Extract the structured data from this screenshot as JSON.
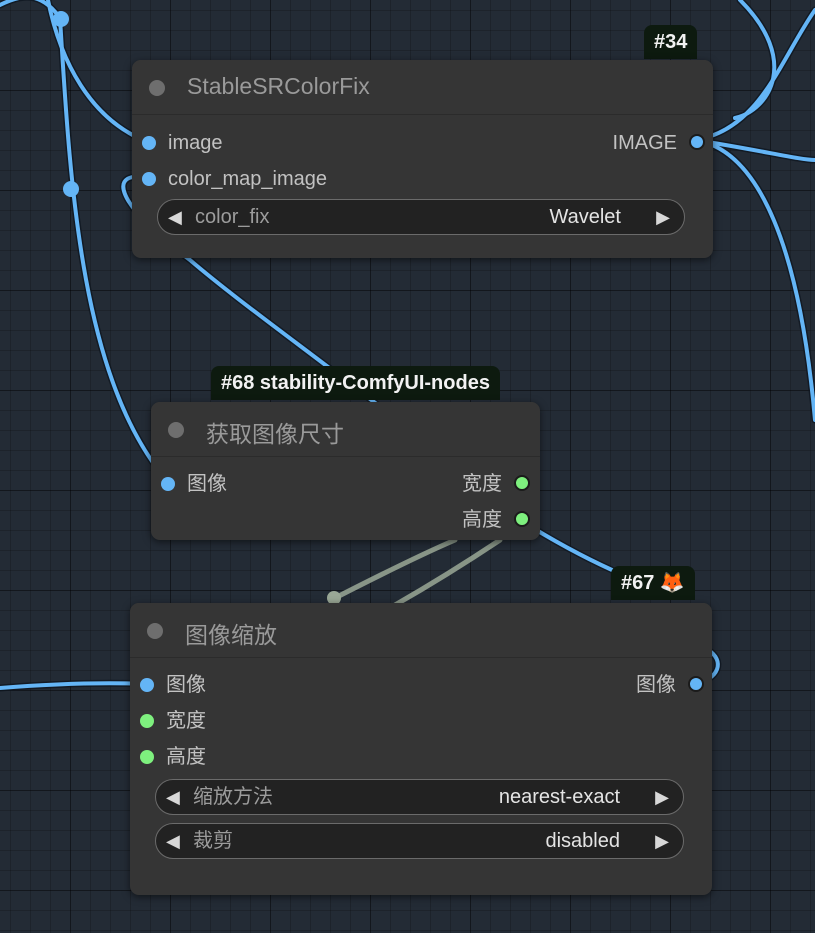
{
  "canvas": {
    "background": "#232b35",
    "link_color_image": "#64b5f6",
    "link_color_int": "#9aa896"
  },
  "nodes": {
    "color_fix": {
      "badge": "#34",
      "title": "StableSRColorFix",
      "inputs": [
        {
          "label": "image",
          "type": "IMAGE"
        },
        {
          "label": "color_map_image",
          "type": "IMAGE"
        }
      ],
      "outputs": [
        {
          "label": "IMAGE",
          "type": "IMAGE"
        }
      ],
      "widgets": [
        {
          "label": "color_fix",
          "value": "Wavelet"
        }
      ]
    },
    "get_size": {
      "badge": "#68 stability-ComfyUI-nodes",
      "title": "获取图像尺寸",
      "inputs": [
        {
          "label": "图像",
          "type": "IMAGE"
        }
      ],
      "outputs": [
        {
          "label": "宽度",
          "type": "INT"
        },
        {
          "label": "高度",
          "type": "INT"
        }
      ]
    },
    "scale": {
      "badge": "#67 🦊",
      "title": "图像缩放",
      "inputs": [
        {
          "label": "图像",
          "type": "IMAGE"
        },
        {
          "label": "宽度",
          "type": "INT"
        },
        {
          "label": "高度",
          "type": "INT"
        }
      ],
      "outputs": [
        {
          "label": "图像",
          "type": "IMAGE"
        }
      ],
      "widgets": [
        {
          "label": "缩放方法",
          "value": "nearest-exact"
        },
        {
          "label": "裁剪",
          "value": "disabled"
        }
      ]
    }
  },
  "icons": {
    "arrow_left": "◀",
    "arrow_right": "▶"
  }
}
